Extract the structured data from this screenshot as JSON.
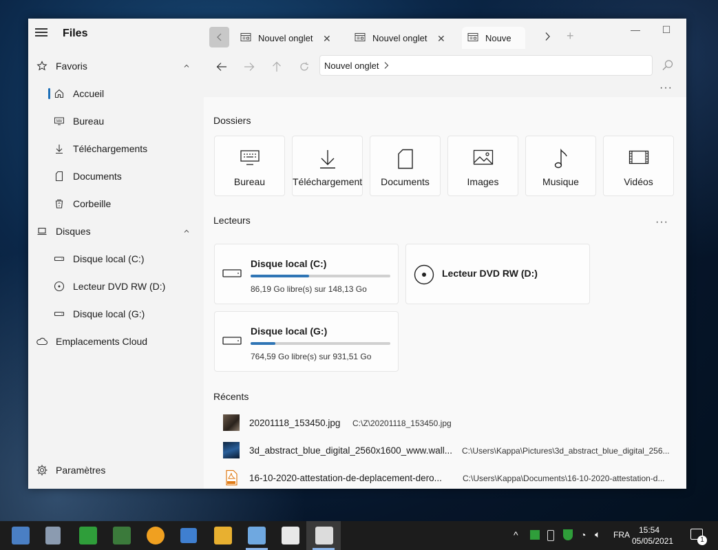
{
  "app": {
    "title": "Files"
  },
  "sidebar": {
    "favorites_label": "Favoris",
    "favorites": [
      {
        "label": "Accueil",
        "icon": "home-icon"
      },
      {
        "label": "Bureau",
        "icon": "desktop-icon"
      },
      {
        "label": "Téléchargements",
        "icon": "download-icon"
      },
      {
        "label": "Documents",
        "icon": "document-icon"
      },
      {
        "label": "Corbeille",
        "icon": "recycle-bin-icon"
      }
    ],
    "drives_label": "Disques",
    "drives": [
      {
        "label": "Disque local (C:)",
        "icon": "drive-icon"
      },
      {
        "label": "Lecteur DVD RW (D:)",
        "icon": "dvd-icon"
      },
      {
        "label": "Disque local (G:)",
        "icon": "drive-icon"
      }
    ],
    "cloud_label": "Emplacements Cloud",
    "settings_label": "Paramètres"
  },
  "tabs": [
    {
      "label": "Nouvel onglet"
    },
    {
      "label": "Nouvel onglet"
    },
    {
      "label": "Nouve"
    }
  ],
  "address": {
    "crumb": "Nouvel onglet"
  },
  "sections": {
    "folders": "Dossiers",
    "drives": "Lecteurs",
    "recent": "Récents"
  },
  "folders": [
    {
      "label": "Bureau",
      "icon": "desktop-icon"
    },
    {
      "label": "Téléchargements",
      "icon": "download-icon"
    },
    {
      "label": "Documents",
      "icon": "document-icon"
    },
    {
      "label": "Images",
      "icon": "image-icon"
    },
    {
      "label": "Musique",
      "icon": "music-icon"
    },
    {
      "label": "Vidéos",
      "icon": "video-icon"
    }
  ],
  "drive_cards": [
    {
      "name": "Disque local (C:)",
      "free": "86,19 Go libre(s) sur 148,13 Go",
      "used_fraction": 0.418
    },
    {
      "name": "Lecteur DVD RW (D:)"
    },
    {
      "name": "Disque local (G:)",
      "free": "764,59 Go libre(s) sur 931,51 Go",
      "used_fraction": 0.179
    }
  ],
  "recent": [
    {
      "name": "20201118_153450.jpg",
      "path": "C:\\Z\\20201118_153450.jpg"
    },
    {
      "name": "3d_abstract_blue_digital_2560x1600_www.wall...",
      "path": "C:\\Users\\Kappa\\Pictures\\3d_abstract_blue_digital_256..."
    },
    {
      "name": "16-10-2020-attestation-de-deplacement-dero...",
      "path": "C:\\Users\\Kappa\\Documents\\16-10-2020-attestation-d..."
    }
  ],
  "taskbar": {
    "language": "FRA",
    "time": "15:54",
    "date": "05/05/2021",
    "notifications": "1"
  },
  "colors": {
    "accent": "#1d6fb8",
    "drive_bar": "#2f75b5"
  }
}
